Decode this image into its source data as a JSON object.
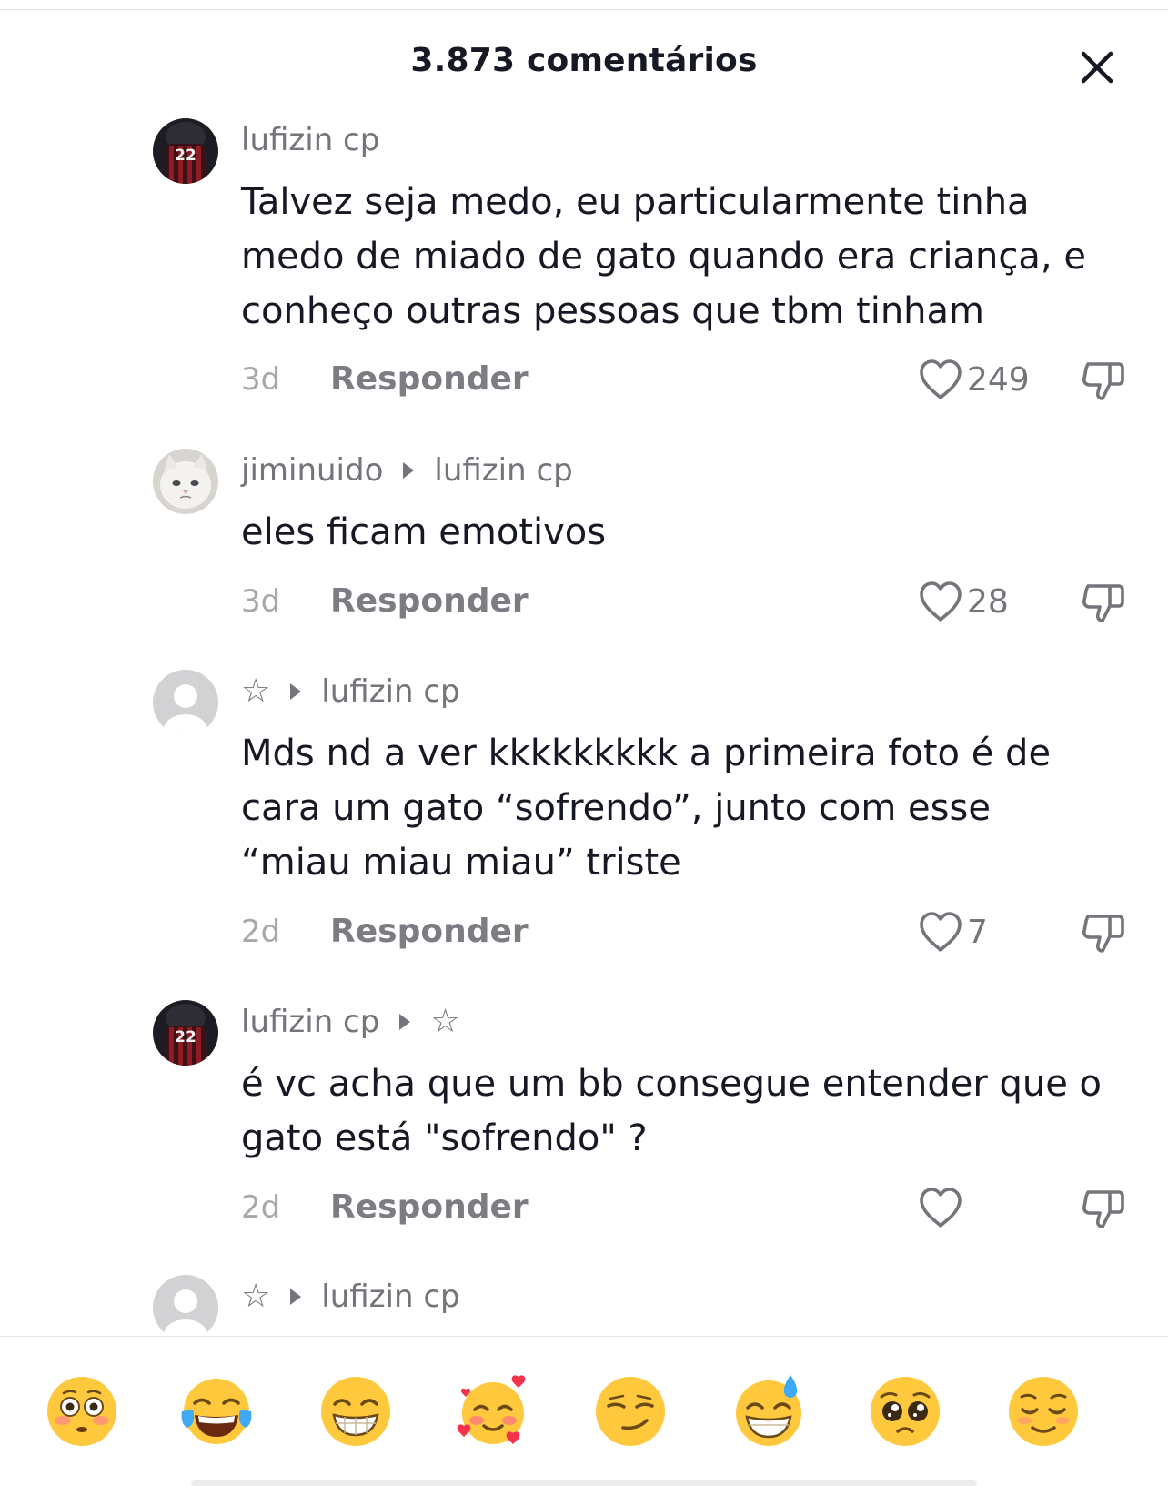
{
  "header": {
    "title": "3.873 comentários"
  },
  "comments": [
    {
      "author": "lufizin cp",
      "reply_to": "",
      "text_lines": [
        "Talvez seja medo, eu particularmente tinha",
        "medo de miado de gato quando era criança, e",
        "conheço outras pessoas que tbm tinham"
      ],
      "age": "3d",
      "reply_label": "Responder",
      "likes": "249",
      "avatar": "jersey-22-avatar"
    },
    {
      "author": "jiminuido",
      "reply_to": "lufizin cp",
      "text_lines": [
        "eles ficam emotivos"
      ],
      "age": "3d",
      "reply_label": "Responder",
      "likes": "28",
      "avatar": "white-cat-avatar"
    },
    {
      "author": "☆",
      "reply_to": "lufizin cp",
      "text_lines": [
        "Mds nd a ver kkkkkkkkk a primeira foto é de",
        "cara um gato “sofrendo”, junto com esse",
        "“miau miau miau” triste"
      ],
      "age": "2d",
      "reply_label": "Responder",
      "likes": "7",
      "avatar": "default-user-avatar"
    },
    {
      "author": "lufizin cp",
      "reply_to": "☆",
      "text_lines": [
        "é vc acha que um bb consegue entender que o",
        "gato está \"sofrendo\" ?"
      ],
      "age": "2d",
      "reply_label": "Responder",
      "likes": "",
      "avatar": "jersey-22-avatar"
    },
    {
      "author": "☆",
      "reply_to": "lufizin cp",
      "text_lines": [],
      "age": "",
      "reply_label": "",
      "likes": "",
      "avatar": "default-user-avatar"
    }
  ],
  "avatar_jersey_number": "22",
  "emoji_bar": [
    "flushed-face",
    "tears-of-joy-face",
    "beaming-grin-face",
    "smiling-face-with-hearts",
    "smirking-face",
    "grinning-sweat-face",
    "pleading-face",
    "relieved-face"
  ],
  "colors": {
    "text_primary": "#161823",
    "text_secondary": "#73757b",
    "text_muted": "#a6a7ab",
    "emoji_yellow": "#ffc83d",
    "heart_red": "#f3334b"
  }
}
